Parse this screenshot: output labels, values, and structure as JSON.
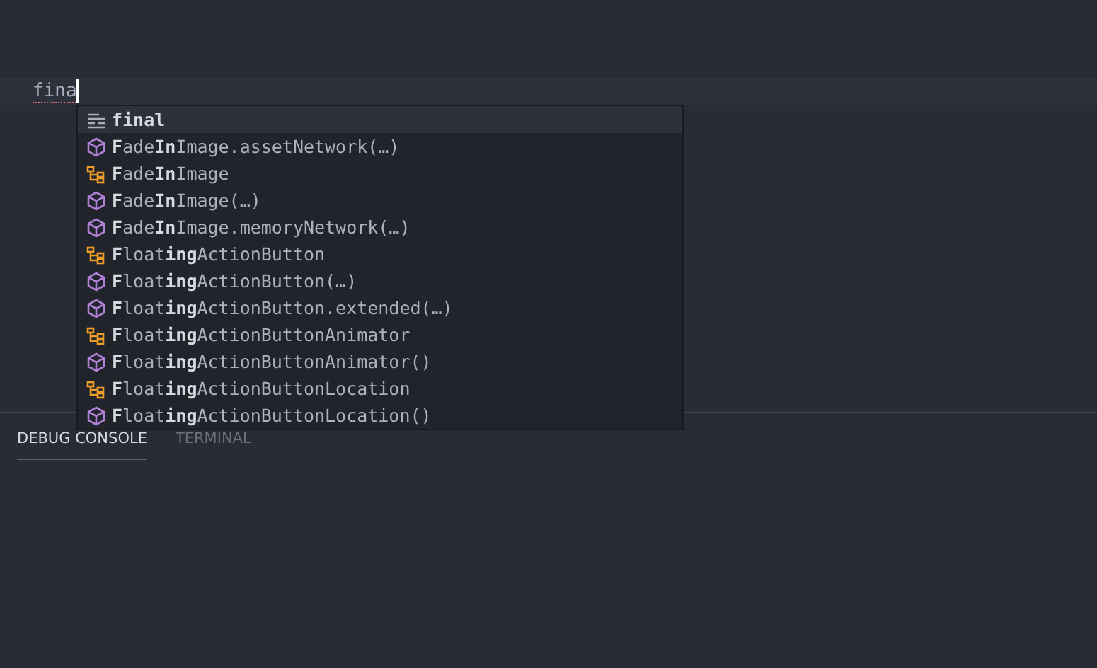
{
  "editor": {
    "line_text": "fina"
  },
  "suggestions": [
    {
      "kind": "keyword",
      "label": "**final**",
      "selected": true
    },
    {
      "kind": "constructor",
      "label": "**F**ade**In**Image.assetNetwork(…)",
      "selected": false
    },
    {
      "kind": "class",
      "label": "**F**ade**In**Image",
      "selected": false
    },
    {
      "kind": "constructor",
      "label": "**F**ade**In**Image(…)",
      "selected": false
    },
    {
      "kind": "constructor",
      "label": "**F**ade**In**Image.memoryNetwork(…)",
      "selected": false
    },
    {
      "kind": "class",
      "label": "**F**loat**ing**ActionButton",
      "selected": false
    },
    {
      "kind": "constructor",
      "label": "**F**loat**ing**ActionButton(…)",
      "selected": false
    },
    {
      "kind": "constructor",
      "label": "**F**loat**ing**ActionButton.extended(…)",
      "selected": false
    },
    {
      "kind": "class",
      "label": "**F**loat**ing**ActionButtonAnimator",
      "selected": false
    },
    {
      "kind": "constructor",
      "label": "**F**loat**ing**ActionButtonAnimator()",
      "selected": false
    },
    {
      "kind": "class",
      "label": "**F**loat**ing**ActionButtonLocation",
      "selected": false
    },
    {
      "kind": "constructor",
      "label": "**F**loat**ing**ActionButtonLocation()",
      "selected": false
    }
  ],
  "panel_tabs": [
    {
      "label": "DEBUG CONSOLE",
      "selected": true
    },
    {
      "label": "TERMINAL",
      "selected": false
    }
  ]
}
